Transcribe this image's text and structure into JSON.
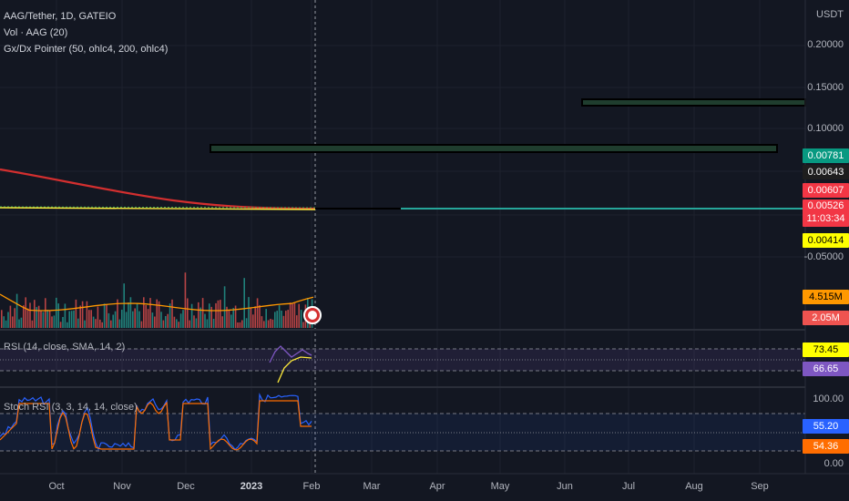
{
  "legend": {
    "symbol": "AAG/Tether, 1D, GATEIO",
    "volume": "Vol · AAG (20)",
    "indicator": "Gx/Dx Pointer (50, ohlc4, 200, ohlc4)"
  },
  "rsi_pane": {
    "label": "RSI (14, close, SMA, 14, 2)",
    "value1": "73.45",
    "value2": "66.65"
  },
  "stoch_pane": {
    "label": "Stoch RSI (3, 3, 14, 14, close)",
    "value1": "55.20",
    "value2": "54.36",
    "axis_top": "100.00",
    "axis_bottom": "0.00"
  },
  "price_axis": {
    "currency": "USDT",
    "ticks": [
      "0.20000",
      "0.15000",
      "0.10000",
      "-0.05000"
    ]
  },
  "price_tags": [
    {
      "value": "0.00781",
      "color": "#089981",
      "text_color": "#ffffff"
    },
    {
      "value": "0.00643",
      "color": "#1e1e1e",
      "text_color": "#ffffff"
    },
    {
      "value": "0.00607",
      "color": "#f23645",
      "text_color": "#ffffff"
    },
    {
      "value": "0.00526",
      "sub": "11:03:34",
      "color": "#f23645",
      "text_color": "#ffffff"
    },
    {
      "value": "0.00414",
      "color": "#ffff00",
      "text_color": "#000000"
    }
  ],
  "volume_tags": [
    {
      "value": "4.515M",
      "color": "#ff9800",
      "text_color": "#000000"
    },
    {
      "value": "2.05M",
      "color": "#ef5350",
      "text_color": "#ffffff"
    }
  ],
  "time_axis": [
    "Oct",
    "Nov",
    "Dec",
    "2023",
    "Feb",
    "Mar",
    "Apr",
    "May",
    "Jun",
    "Jul",
    "Aug",
    "Sep"
  ],
  "colors": {
    "background": "#131722",
    "grid": "#1e222d",
    "ma200": "#d32f2f",
    "ma50": "#ffeb3b",
    "projection": "#26a69a",
    "volume_up": "#26a69a",
    "volume_down": "#ef5350",
    "rsi": "#7e57c2",
    "rsi_ma": "#ffeb3b",
    "stoch_k": "#2962ff",
    "stoch_d": "#ff6d00"
  }
}
